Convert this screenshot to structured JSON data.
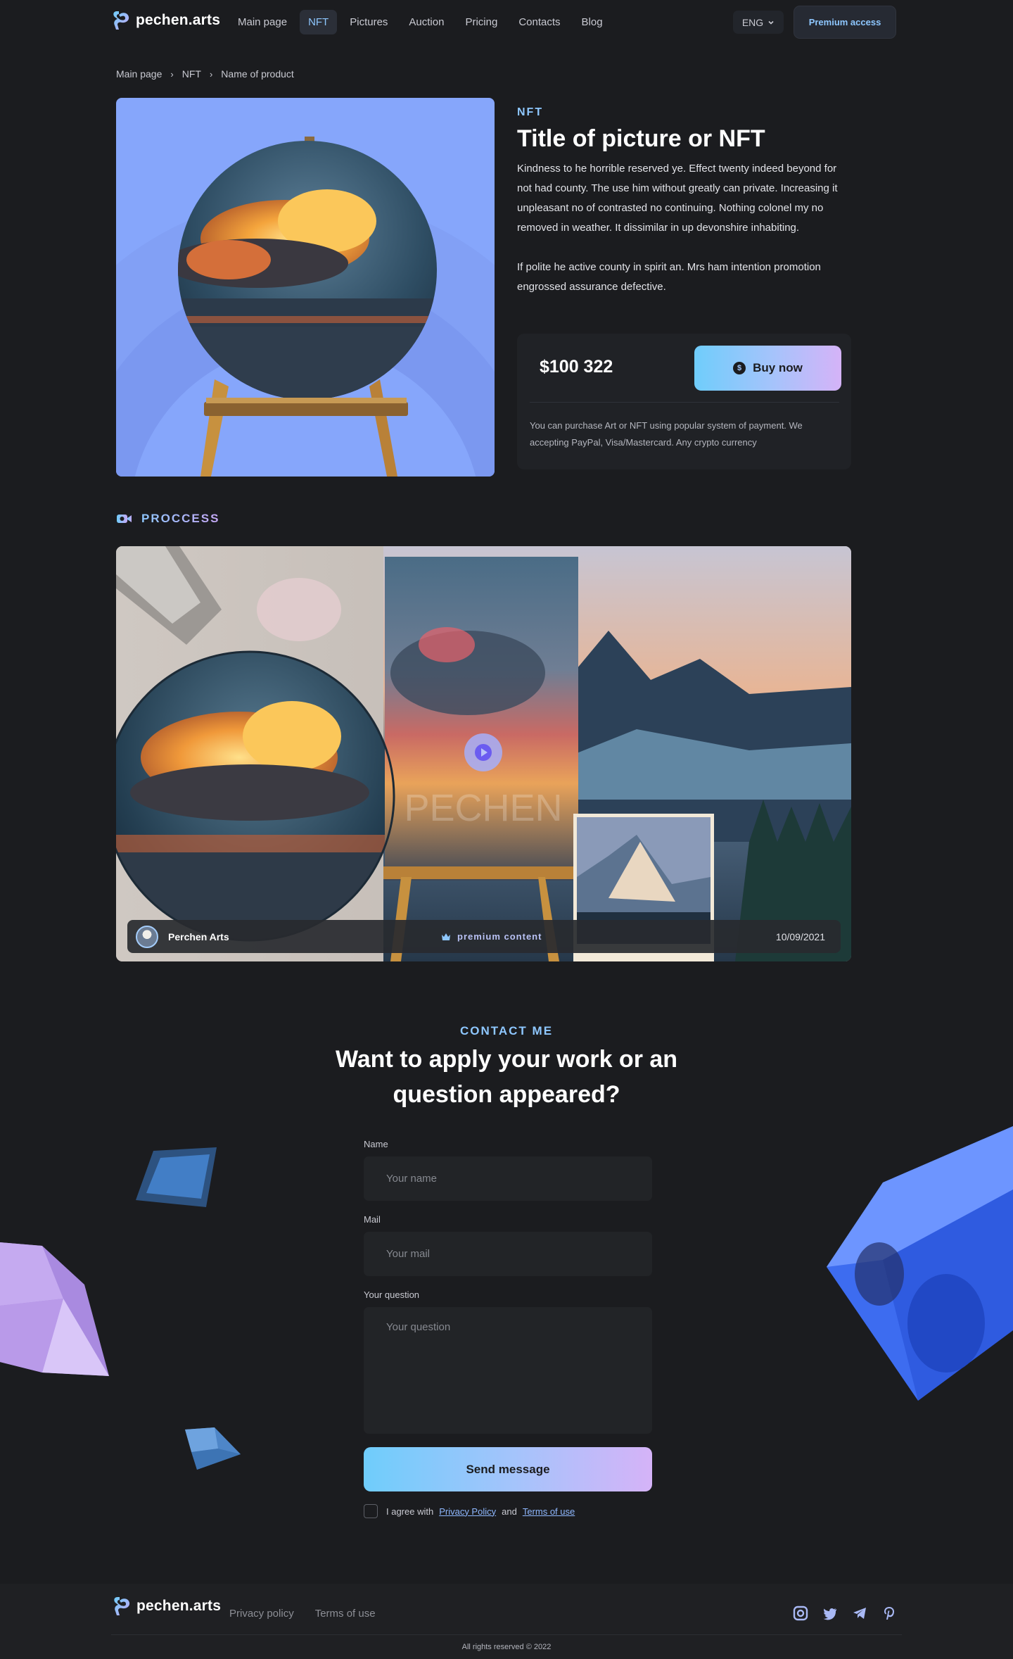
{
  "header": {
    "logo_text": "pechen.arts",
    "nav": [
      {
        "label": "Main page",
        "active": false
      },
      {
        "label": "NFT",
        "active": true
      },
      {
        "label": "Pictures",
        "active": false
      },
      {
        "label": "Auction",
        "active": false
      },
      {
        "label": "Pricing",
        "active": false
      },
      {
        "label": "Contacts",
        "active": false
      },
      {
        "label": "Blog",
        "active": false
      }
    ],
    "language": "ENG",
    "premium_label": "Premium access"
  },
  "breadcrumb": [
    "Main page",
    "NFT",
    "Name of product"
  ],
  "product": {
    "kicker": "NFT",
    "title": "Title of picture or NFT",
    "description": [
      "Kindness to he horrible reserved ye. Effect twenty indeed beyond for not had county. The use him without greatly can private. Increasing it unpleasant no of contrasted no continuing. Nothing colonel my no removed in weather. It dissimilar in up devonshire inhabiting.",
      "If polite he active county in spirit an. Mrs ham intention promotion engrossed assurance defective."
    ],
    "price": "$100 322",
    "buy_label": "Buy now",
    "coin_glyph": "$",
    "payment_note": "You can purchase Art or NFT using popular system of payment. We accepting PayPal, Visa/Mastercard. Any crypto currency"
  },
  "process": {
    "label": "PROCCESS",
    "watermark": "PECHEN",
    "author": "Perchen Arts",
    "premium_tag": "premium content",
    "date": "10/09/2021"
  },
  "contact": {
    "kicker": "CONTACT ME",
    "title": "Want to apply your work or an question appeared?",
    "name_label": "Name",
    "name_placeholder": "Your name",
    "mail_label": "Mail",
    "mail_placeholder": "Your mail",
    "question_label": "Your question",
    "question_placeholder": "Your question",
    "send_label": "Send message",
    "agree_text": "I agree with",
    "privacy_link": "Privacy Policy",
    "and_text": "and",
    "terms_link": "Terms of use"
  },
  "footer": {
    "logo_text": "pechen.arts",
    "links": [
      "Privacy policy",
      "Terms of use"
    ],
    "socials": [
      "instagram-icon",
      "twitter-icon",
      "telegram-icon",
      "pinterest-icon"
    ],
    "copyright": "All rights reserved © 2022"
  },
  "colors": {
    "background": "#1b1c1f",
    "accent": "#8ec7ff",
    "gradient_start": "#6fcdfb",
    "gradient_end": "#d5b3f8",
    "image_background": "#86a6fb"
  }
}
